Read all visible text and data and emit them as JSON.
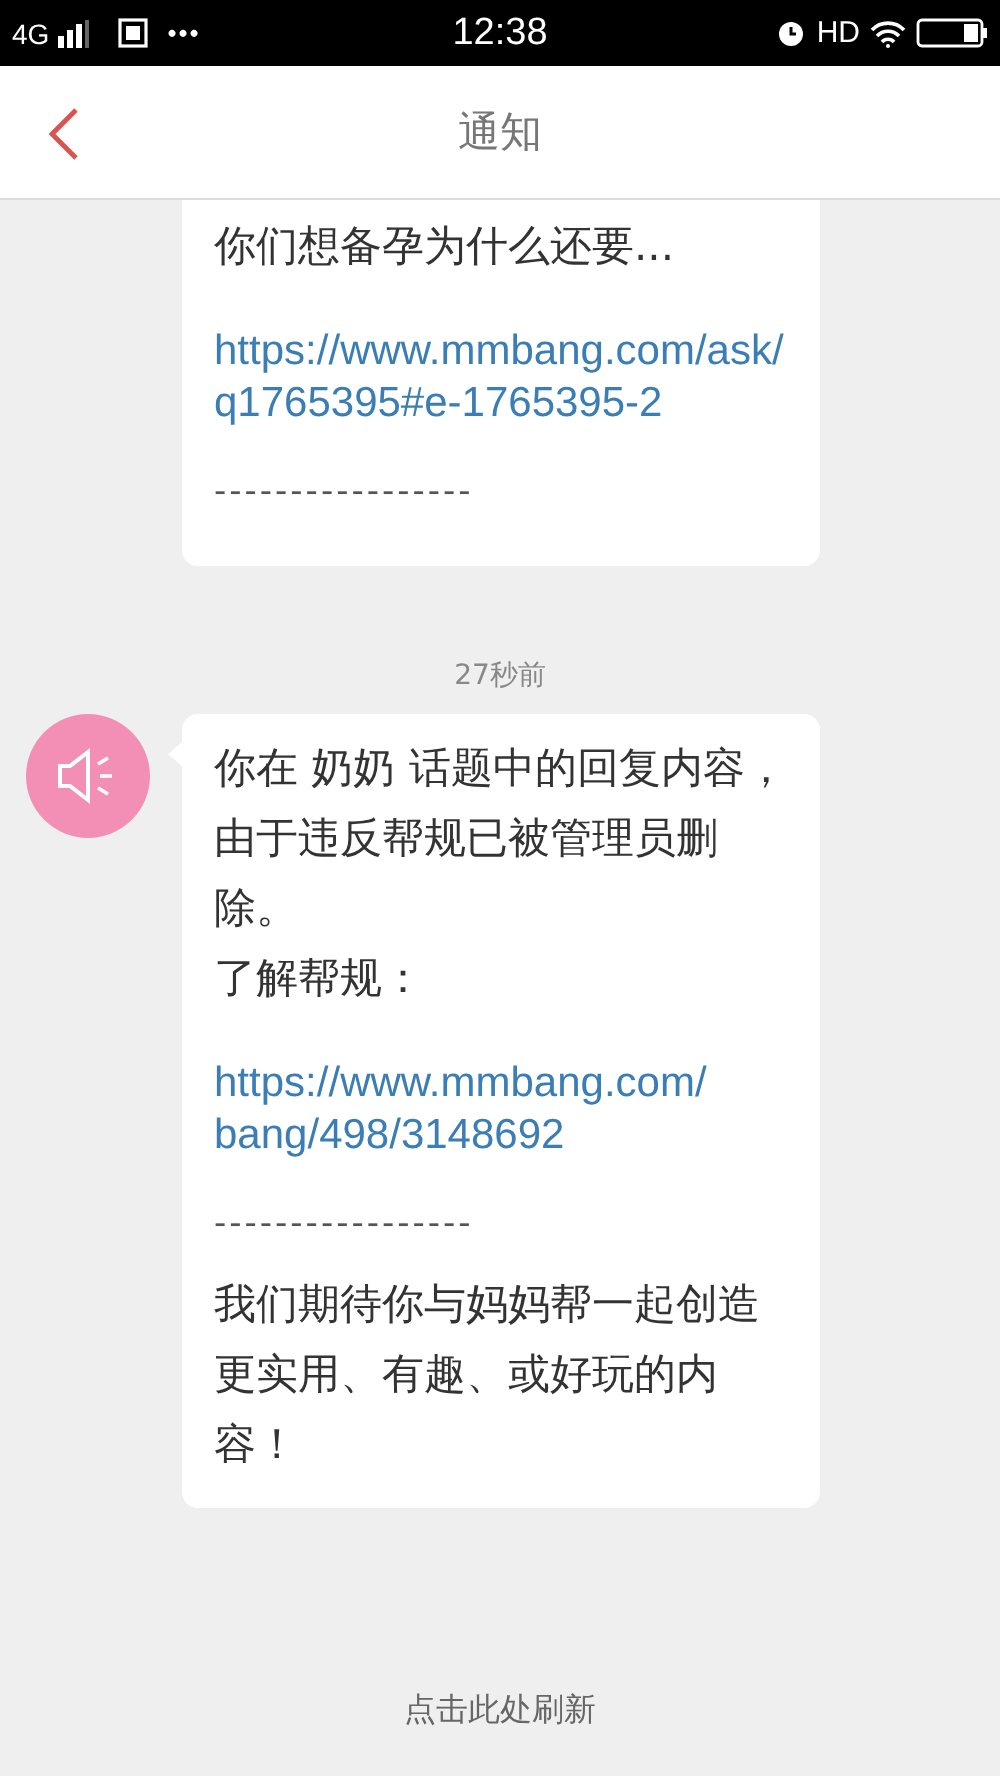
{
  "status_bar": {
    "network": "4G",
    "more": "•••",
    "time": "12:38",
    "hd": "HD"
  },
  "nav": {
    "title": "通知"
  },
  "messages": [
    {
      "blocks": [
        {
          "kind": "text",
          "text": "你们想备孕为什么还要..."
        },
        {
          "kind": "link",
          "text": "https://www.mmbang.com/ask/q1765395#e-1765395-2"
        },
        {
          "kind": "rule",
          "text": "-----------------"
        }
      ]
    },
    {
      "time": "27秒前",
      "blocks": [
        {
          "kind": "text",
          "text": "你在 奶奶 话题中的回复内容，由于违反帮规已被管理员删除。"
        },
        {
          "kind": "text",
          "text": "了解帮规："
        },
        {
          "kind": "link",
          "text": "https://www.mmbang.com/bang/498/3148692"
        },
        {
          "kind": "rule",
          "text": "-----------------"
        },
        {
          "kind": "text",
          "text": "我们期待你与妈妈帮一起创造更实用、有趣、或好玩的内容！"
        }
      ]
    }
  ],
  "footer": {
    "refresh": "点击此处刷新"
  }
}
